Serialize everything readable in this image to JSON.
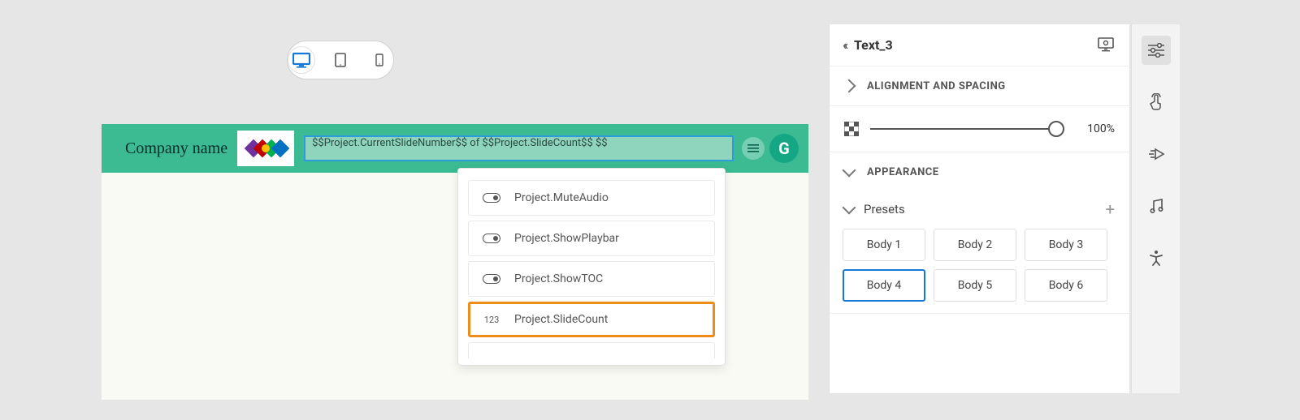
{
  "devices": {
    "active": "desktop"
  },
  "banner": {
    "company_label": "Company name",
    "variable_text": "$$Project.CurrentSlideNumber$$ of $$Project.SlideCount$$ $$"
  },
  "dropdown": {
    "items": [
      {
        "type": "toggle",
        "label": "Project.MuteAudio"
      },
      {
        "type": "toggle",
        "label": "Project.ShowPlaybar"
      },
      {
        "type": "toggle",
        "label": "Project.ShowTOC"
      },
      {
        "type": "number",
        "label": "Project.SlideCount",
        "highlighted": true
      }
    ],
    "number_badge": "123"
  },
  "panel": {
    "title": "Text_3",
    "sections": {
      "alignment": "ALIGNMENT AND SPACING",
      "appearance": "APPEARANCE"
    },
    "opacity": {
      "value": "100%",
      "position": 100
    },
    "presets": {
      "label": "Presets",
      "items": [
        "Body 1",
        "Body 2",
        "Body 3",
        "Body 4",
        "Body 5",
        "Body 6"
      ],
      "selected": "Body 4"
    }
  },
  "rail": {
    "icons": [
      "properties",
      "interactions",
      "animations",
      "audio",
      "accessibility"
    ],
    "active": "properties"
  }
}
